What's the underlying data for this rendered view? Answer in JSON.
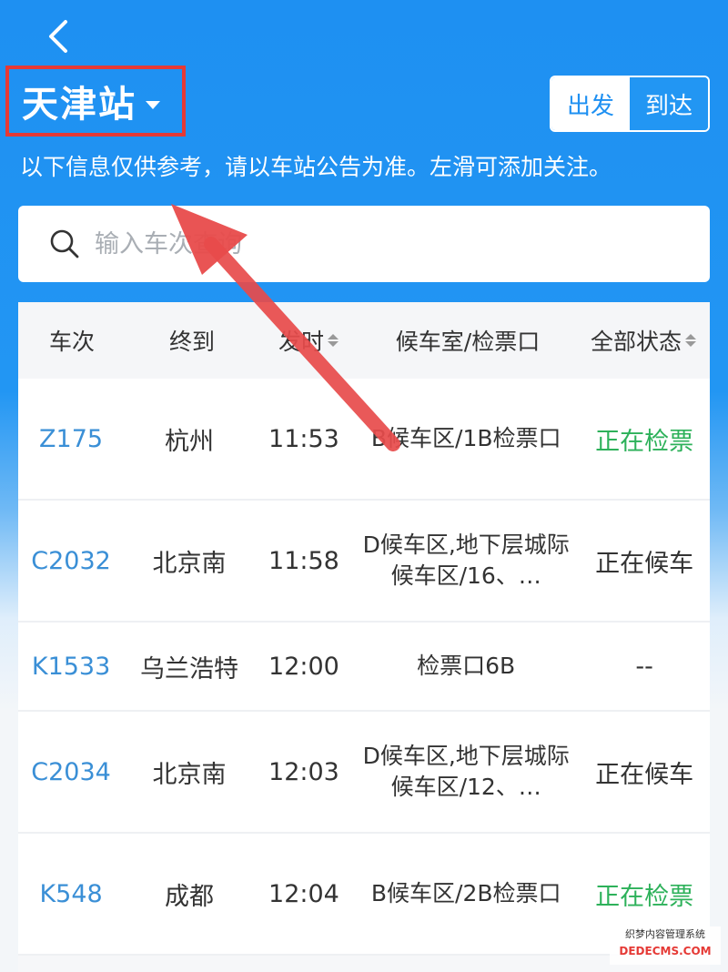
{
  "header": {
    "station": "天津站",
    "toggle": {
      "depart": "出发",
      "arrive": "到达"
    },
    "notice": "以下信息仅供参考，请以车站公告为准。左滑可添加关注。"
  },
  "search": {
    "placeholder": "输入车次查询"
  },
  "table": {
    "columns": [
      "车次",
      "终到",
      "发时",
      "候车室/检票口",
      "全部状态"
    ],
    "rows": [
      {
        "train": "Z175",
        "dest": "杭州",
        "time": "11:53",
        "wait": "B候车区/1B检票口",
        "status": "正在检票"
      },
      {
        "train": "C2032",
        "dest": "北京南",
        "time": "11:58",
        "wait": "D候车区,地下层城际候车区/16、…",
        "status": "正在候车"
      },
      {
        "train": "K1533",
        "dest": "乌兰浩特",
        "time": "12:00",
        "wait": "检票口6B",
        "status": "--"
      },
      {
        "train": "C2034",
        "dest": "北京南",
        "time": "12:03",
        "wait": "D候车区,地下层城际候车区/12、…",
        "status": "正在候车"
      },
      {
        "train": "K548",
        "dest": "成都",
        "time": "12:04",
        "wait": "B候车区/2B检票口",
        "status": "正在检票"
      }
    ]
  },
  "watermark": {
    "line1": "织梦内容管理系统",
    "line2": "DEDECMS.COM"
  },
  "colors": {
    "primary": "#1e90f2",
    "train_link": "#3a8fd6",
    "status_active": "#2db15a",
    "highlight": "#e53935"
  }
}
